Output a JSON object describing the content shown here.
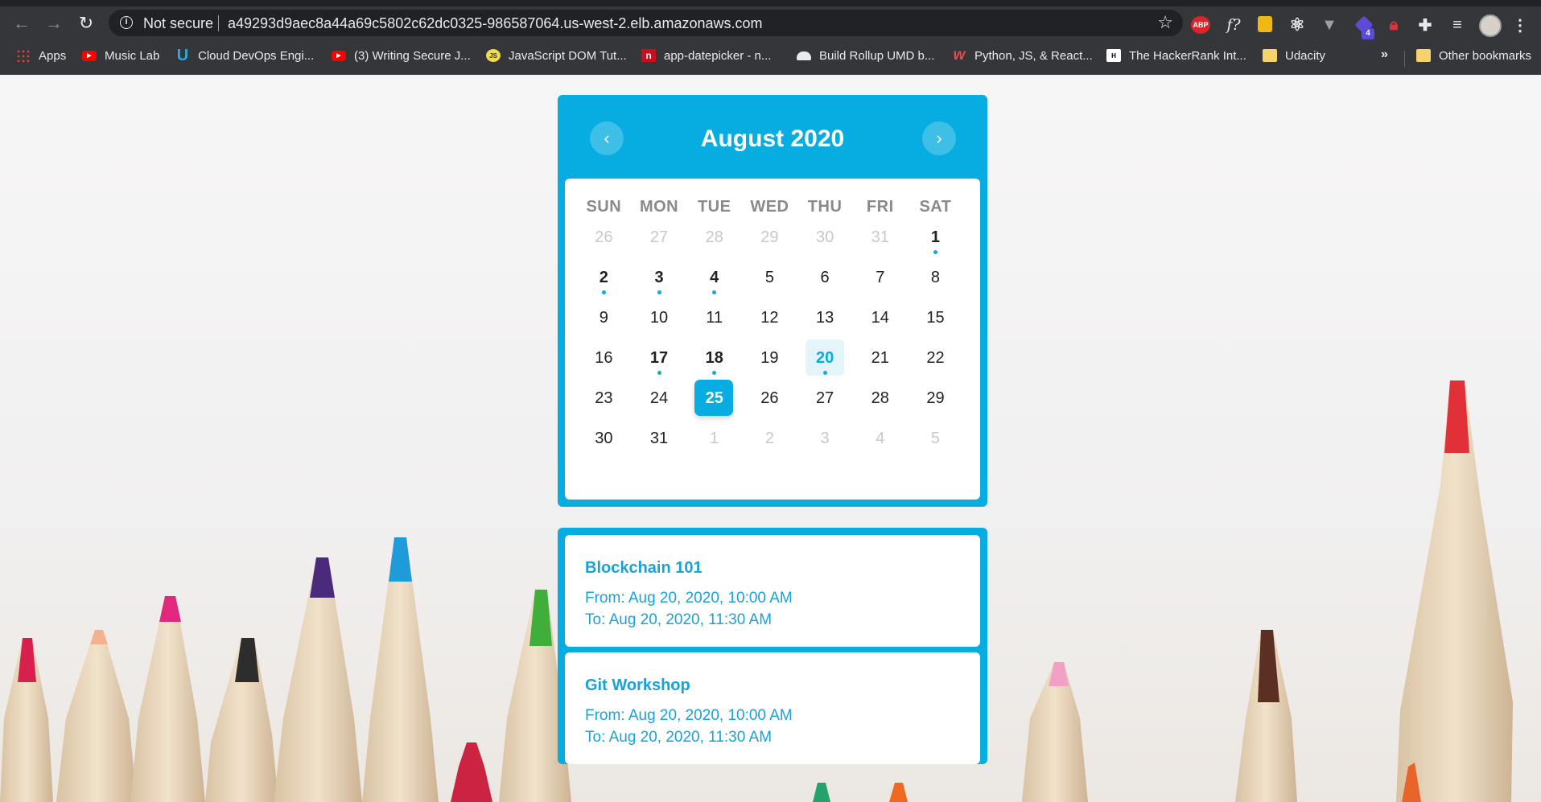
{
  "browser": {
    "security_label": "Not secure",
    "url": "a49293d9aec8a44a69c5802c62dc0325-986587064.us-west-2.elb.amazonaws.com",
    "extensions": {
      "abp_label": "ABP",
      "f_label": "f?",
      "tag_badge": "4"
    },
    "bookmarks": [
      {
        "label": "Apps",
        "icon": "apps-grid-icon"
      },
      {
        "label": "Music Lab",
        "icon": "youtube-icon"
      },
      {
        "label": "Cloud DevOps Engi...",
        "icon": "udacity-icon"
      },
      {
        "label": "(3) Writing Secure J...",
        "icon": "youtube-icon"
      },
      {
        "label": "JavaScript DOM Tut...",
        "icon": "js-icon"
      },
      {
        "label": "app-datepicker - n...",
        "icon": "npm-icon"
      },
      {
        "label": "Build Rollup UMD b...",
        "icon": "rollup-icon"
      },
      {
        "label": "Python, JS, & React...",
        "icon": "wes-bos-icon"
      },
      {
        "label": "The HackerRank Int...",
        "icon": "hackerrank-icon"
      },
      {
        "label": "Udacity",
        "icon": "folder-icon"
      }
    ],
    "more_label": "»",
    "other_bookmarks": "Other bookmarks"
  },
  "calendar": {
    "title": "August 2020",
    "prev_label": "‹",
    "next_label": "›",
    "weekdays": [
      "SUN",
      "MON",
      "TUE",
      "WED",
      "THU",
      "FRI",
      "SAT"
    ],
    "weeks": [
      [
        {
          "d": "26",
          "m": true
        },
        {
          "d": "27",
          "m": true
        },
        {
          "d": "28",
          "m": true
        },
        {
          "d": "29",
          "m": true
        },
        {
          "d": "30",
          "m": true
        },
        {
          "d": "31",
          "m": true
        },
        {
          "d": "1",
          "e": true
        }
      ],
      [
        {
          "d": "2",
          "e": true
        },
        {
          "d": "3",
          "e": true
        },
        {
          "d": "4",
          "e": true
        },
        {
          "d": "5"
        },
        {
          "d": "6"
        },
        {
          "d": "7"
        },
        {
          "d": "8"
        }
      ],
      [
        {
          "d": "9"
        },
        {
          "d": "10"
        },
        {
          "d": "11"
        },
        {
          "d": "12"
        },
        {
          "d": "13"
        },
        {
          "d": "14"
        },
        {
          "d": "15"
        }
      ],
      [
        {
          "d": "16"
        },
        {
          "d": "17",
          "e": true
        },
        {
          "d": "18",
          "e": true
        },
        {
          "d": "19"
        },
        {
          "d": "20",
          "e": true,
          "selected": true
        },
        {
          "d": "21"
        },
        {
          "d": "22"
        }
      ],
      [
        {
          "d": "23"
        },
        {
          "d": "24"
        },
        {
          "d": "25",
          "today": true
        },
        {
          "d": "26"
        },
        {
          "d": "27"
        },
        {
          "d": "28"
        },
        {
          "d": "29"
        }
      ],
      [
        {
          "d": "30"
        },
        {
          "d": "31"
        },
        {
          "d": "1",
          "m": true
        },
        {
          "d": "2",
          "m": true
        },
        {
          "d": "3",
          "m": true
        },
        {
          "d": "4",
          "m": true
        },
        {
          "d": "5",
          "m": true
        }
      ]
    ]
  },
  "events": [
    {
      "title": "Blockchain 101",
      "from": "From: Aug 20, 2020, 10:00 AM",
      "to": "To: Aug 20, 2020, 11:30 AM"
    },
    {
      "title": "Git Workshop",
      "from": "From: Aug 20, 2020, 10:00 AM",
      "to": "To: Aug 20, 2020, 11:30 AM"
    }
  ],
  "colors": {
    "accent": "#07ade0",
    "selected_bg": "#e3f4fb",
    "chrome_dark": "#35363a"
  }
}
